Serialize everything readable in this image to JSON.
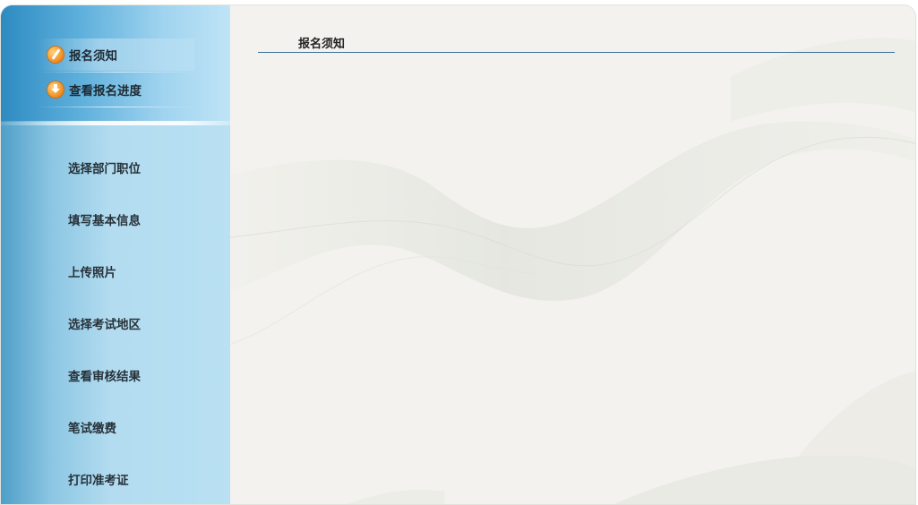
{
  "top_menu": [
    {
      "label": "报名须知",
      "icon": "pen-icon"
    },
    {
      "label": "查看报名进度",
      "icon": "download-icon"
    }
  ],
  "nav": {
    "items": [
      {
        "label": "选择部门职位"
      },
      {
        "label": "填写基本信息"
      },
      {
        "label": "上传照片"
      },
      {
        "label": "选择考试地区"
      },
      {
        "label": "查看审核结果"
      },
      {
        "label": "笔试缴费"
      },
      {
        "label": "打印准考证"
      }
    ]
  },
  "content": {
    "title": "报名须知"
  },
  "colors": {
    "sidebar_dark": "#2d8bc1",
    "sidebar_light": "#b9e0f3",
    "content_bg": "#f3f2ee",
    "title_rule": "#3a6f9a"
  }
}
